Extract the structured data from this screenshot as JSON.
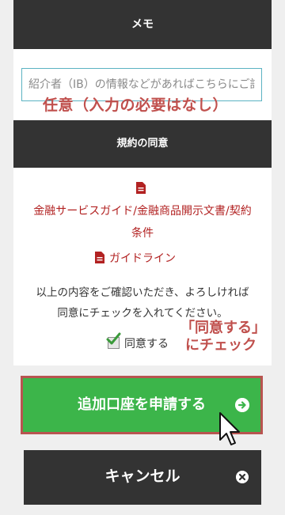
{
  "memo": {
    "header": "メモ",
    "placeholder": "紹介者（IB）の情報などがあればこちらにご記入ください",
    "note": "任意（入力の必要はなし）"
  },
  "terms": {
    "header": "規約の同意",
    "doc1_line1": "金融サービスガイド/金融商品開示文書/契約",
    "doc1_line2": "条件",
    "doc2": "ガイドライン",
    "notice_line1": "以上の内容をご確認いただき、よろしければ",
    "notice_line2": "同意にチェックを入れてください。",
    "agree_label": "同意する"
  },
  "callout": {
    "line1": "「同意する」",
    "line2": "にチェック"
  },
  "actions": {
    "apply_label": "追加口座を申請する",
    "cancel_label": "キャンセル"
  },
  "icons": [
    "document-icon",
    "checkmark-icon",
    "arrow-right-circle-icon",
    "close-circle-icon",
    "mouse-cursor-icon"
  ],
  "colors": {
    "header_bg": "#333333",
    "link": "#b22222",
    "annotation": "#c0504d",
    "apply_bg": "#3cb54a",
    "input_border": "#5bb3c2"
  }
}
